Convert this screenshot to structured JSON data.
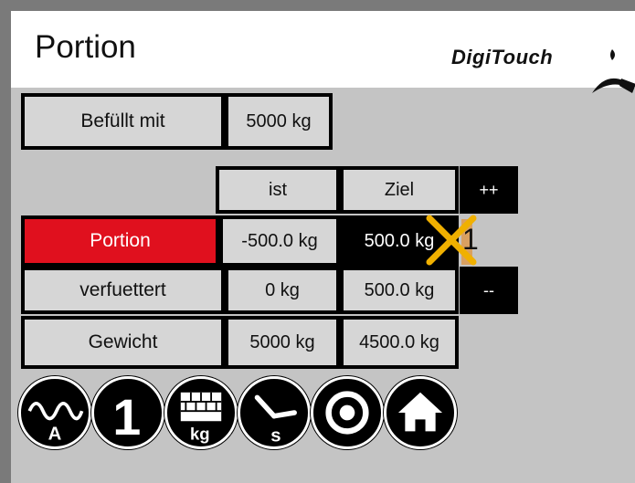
{
  "header": {
    "title": "Portion",
    "brand": "DigiTouch"
  },
  "filled": {
    "label": "Befüllt mit",
    "value": "5000 kg"
  },
  "columns": {
    "actual": "ist",
    "target": "Ziel"
  },
  "rows": [
    {
      "label": "Portion",
      "actual": "-500.0 kg",
      "target": "500.0 kg"
    },
    {
      "label": "verfuettert",
      "actual": "0 kg",
      "target": "500.0 kg"
    },
    {
      "label": "Gewicht",
      "actual": "5000 kg",
      "target": "4500.0 kg"
    }
  ],
  "controls": {
    "increment": "++",
    "decrement": "--",
    "portion_number": "1"
  },
  "nav": [
    {
      "name": "auto-mode",
      "icon": "sine-wave-a-icon",
      "text": "A"
    },
    {
      "name": "number-one",
      "icon": "digit-one-icon",
      "text": "1"
    },
    {
      "name": "weight-kg",
      "icon": "bricks-kg-icon",
      "text": "kg"
    },
    {
      "name": "time-s",
      "icon": "clock-s-icon",
      "text": "s"
    },
    {
      "name": "target",
      "icon": "target-circle-icon",
      "text": ""
    },
    {
      "name": "home",
      "icon": "home-icon",
      "text": ""
    }
  ],
  "colors": {
    "active_row": "#e0101e",
    "background": "#c4c4c4",
    "frame": "#7a7a7a",
    "overlay_x": "#f0b000"
  }
}
